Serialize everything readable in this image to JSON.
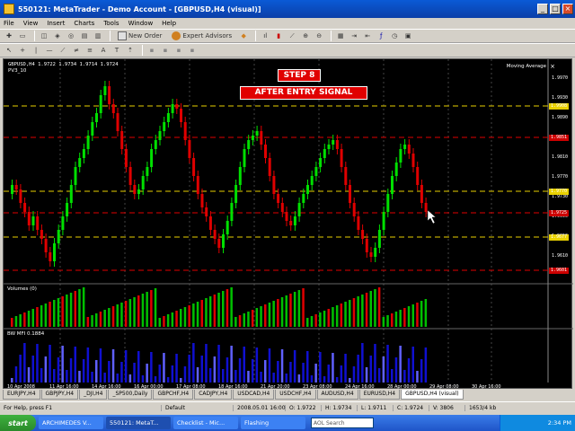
{
  "window": {
    "title": "550121: MetaTrader - Demo Account - [GBPUSD,H4 (visual)]"
  },
  "menu": [
    "File",
    "View",
    "Insert",
    "Charts",
    "Tools",
    "Window",
    "Help"
  ],
  "toolbar": {
    "new_order": "New Order",
    "expert_advisors": "Expert Advisors"
  },
  "chart": {
    "symbol_info": "GBPUSD,H4  1.9722 1.9734 1.9714 1.9724",
    "ea_name": "PV3_10",
    "indicator_label": "Moving Average",
    "volumes_label": "Volumes (0)",
    "mfi_label": "BW MFI 0.1884",
    "step_text": "STEP 8",
    "signal_text": "AFTER ENTRY SIGNAL",
    "price_axis": [
      "1.9970",
      "1.9930",
      "1.9890",
      "1.9850",
      "1.9810",
      "1.9770",
      "1.9730",
      "1.9690",
      "1.9650",
      "1.9610"
    ],
    "price_tags": [
      {
        "label": "1.9908",
        "color": "#e8d000"
      },
      {
        "label": "1.9851",
        "color": "#cc0000"
      },
      {
        "label": "1.9770",
        "color": "#e8d000"
      },
      {
        "label": "1.9725",
        "color": "#cc0000"
      },
      {
        "label": "1.9677",
        "color": "#e8d000"
      },
      {
        "label": "1.9601",
        "color": "#cc0000"
      }
    ],
    "time_axis": [
      "10 Apr 2008",
      "11 Apr 16:00",
      "14 Apr 16:00",
      "16 Apr 00:00",
      "17 Apr 08:00",
      "18 Apr 16:00",
      "21 Apr 20:00",
      "23 Apr 08:00",
      "24 Apr 16:00",
      "28 Apr 00:00",
      "29 Apr 08:00",
      "30 Apr 16:00"
    ]
  },
  "symbol_tabs": [
    "EURJPY,H4",
    "GBPJPY,H4",
    "_DJI,H4",
    "_SP500,Daily",
    "GBPCHF,H4",
    "CADJPY,H4",
    "USDCAD,H4",
    "USDCHF,H4",
    "AUDUSD,H4",
    "EURUSD,H4",
    "GBPUSD,H4 (visual)"
  ],
  "active_symbol_tab": 10,
  "status": {
    "help": "For Help, press F1",
    "profile": "Default",
    "datetime": "2008.05.01 16:00",
    "open": "O: 1.9722",
    "high": "H: 1.9734",
    "low": "L: 1.9711",
    "close": "C: 1.9724",
    "volume": "V: 3806",
    "traffic": "1653/4 kb"
  },
  "taskbar": {
    "start": "start",
    "items": [
      "ARCHIMEDES V...",
      "550121: MetaT...",
      "Checklist - Mic...",
      "Flashing"
    ],
    "active_item": 1,
    "search_placeholder": "AOL Search",
    "clock": "2:34 PM"
  },
  "colors": {
    "bull": "#00e000",
    "bear": "#e00000",
    "level_yellow": "#e8d000",
    "volume_green": "#00c000",
    "mfi_blue": "#1010d0"
  }
}
